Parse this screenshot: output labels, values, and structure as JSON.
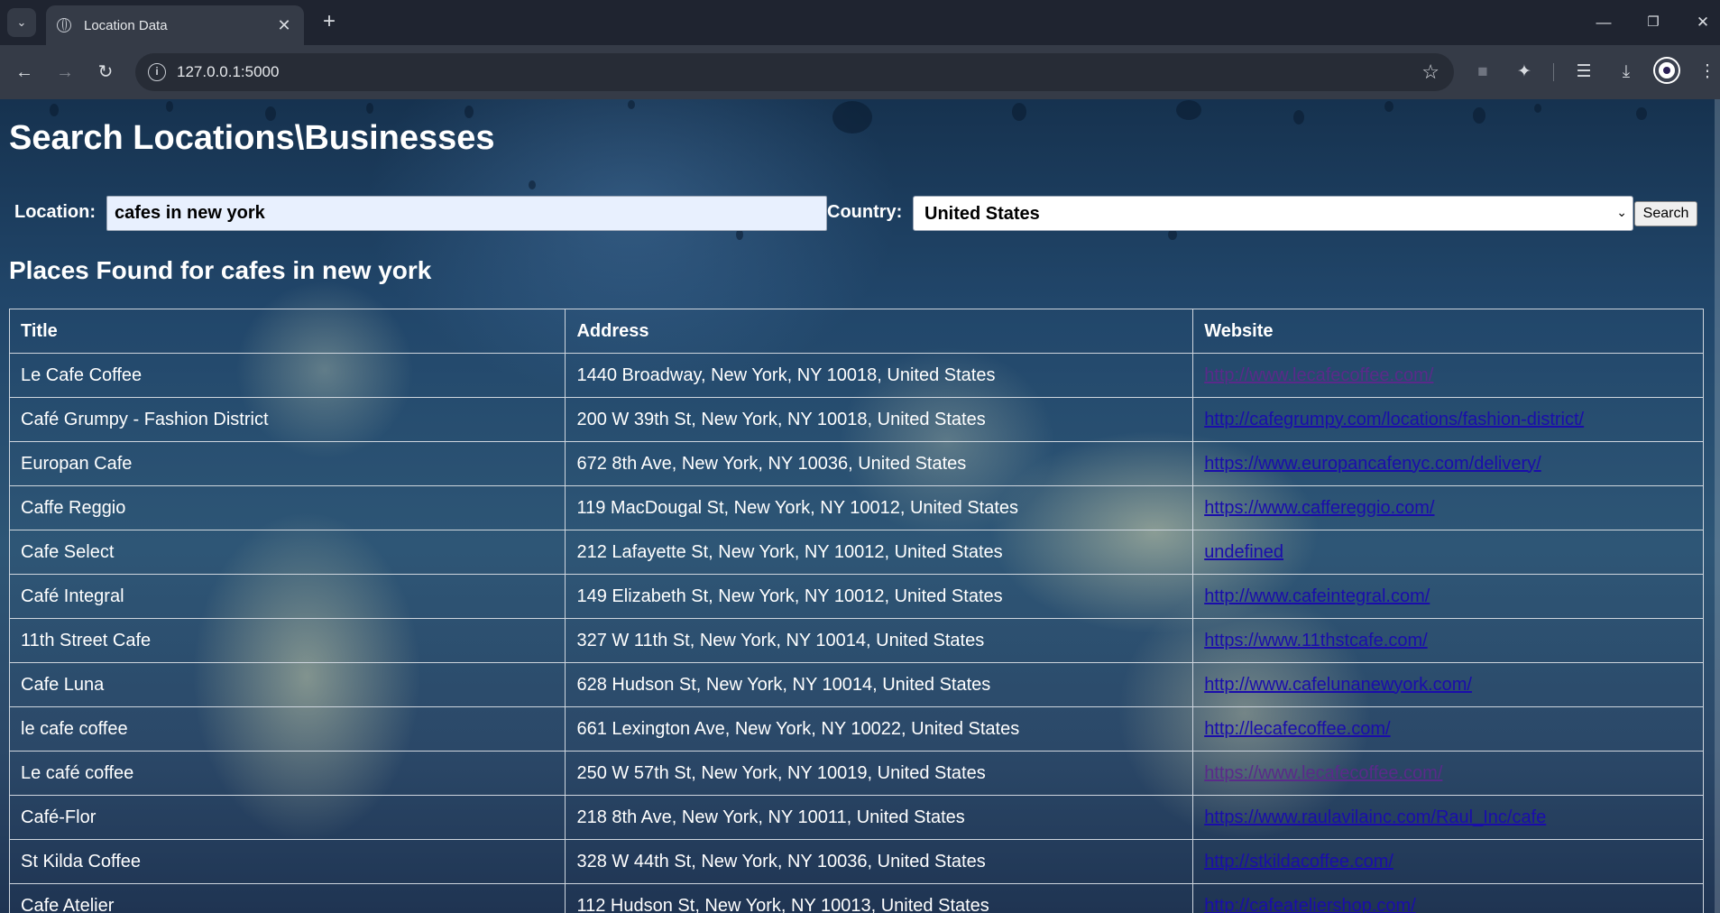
{
  "browser": {
    "tab_title": "Location Data",
    "url": "127.0.0.1:5000"
  },
  "page": {
    "title": "Search Locations\\Businesses",
    "location_label": "Location:",
    "location_value": "cafes in new york",
    "country_label": "Country:",
    "country_value": "United States",
    "search_button": "Search",
    "results_title": "Places Found for cafes in new york"
  },
  "table": {
    "headers": [
      "Title",
      "Address",
      "Website"
    ],
    "rows": [
      {
        "title": "Le Cafe Coffee",
        "address": "1440 Broadway, New York, NY 10018, United States",
        "website": "http://www.lecafecoffee.com/",
        "visited": true
      },
      {
        "title": "Café Grumpy - Fashion District",
        "address": "200 W 39th St, New York, NY 10018, United States",
        "website": "http://cafegrumpy.com/locations/fashion-district/",
        "visited": false
      },
      {
        "title": "Europan Cafe",
        "address": "672 8th Ave, New York, NY 10036, United States",
        "website": "https://www.europancafenyc.com/delivery/",
        "visited": false
      },
      {
        "title": "Caffe Reggio",
        "address": "119 MacDougal St, New York, NY 10012, United States",
        "website": "https://www.caffereggio.com/",
        "visited": false
      },
      {
        "title": "Cafe Select",
        "address": "212 Lafayette St, New York, NY 10012, United States",
        "website": "undefined",
        "visited": false
      },
      {
        "title": "Café Integral",
        "address": "149 Elizabeth St, New York, NY 10012, United States",
        "website": "http://www.cafeintegral.com/",
        "visited": false
      },
      {
        "title": "11th Street Cafe",
        "address": "327 W 11th St, New York, NY 10014, United States",
        "website": "https://www.11thstcafe.com/",
        "visited": false
      },
      {
        "title": "Cafe Luna",
        "address": "628 Hudson St, New York, NY 10014, United States",
        "website": "http://www.cafelunanewyork.com/",
        "visited": false
      },
      {
        "title": "le cafe coffee",
        "address": "661 Lexington Ave, New York, NY 10022, United States",
        "website": "http://lecafecoffee.com/",
        "visited": false
      },
      {
        "title": "Le café coffee",
        "address": "250 W 57th St, New York, NY 10019, United States",
        "website": "https://www.lecafecoffee.com/",
        "visited": true
      },
      {
        "title": "Café-Flor",
        "address": "218 8th Ave, New York, NY 10011, United States",
        "website": "https://www.raulavilainc.com/Raul_Inc/cafe",
        "visited": false
      },
      {
        "title": "St Kilda Coffee",
        "address": "328 W 44th St, New York, NY 10036, United States",
        "website": "http://stkildacoffee.com/",
        "visited": false
      },
      {
        "title": "Cafe Atelier",
        "address": "112 Hudson St, New York, NY 10013, United States",
        "website": "http://cafeateliershop.com/",
        "visited": false
      }
    ]
  }
}
